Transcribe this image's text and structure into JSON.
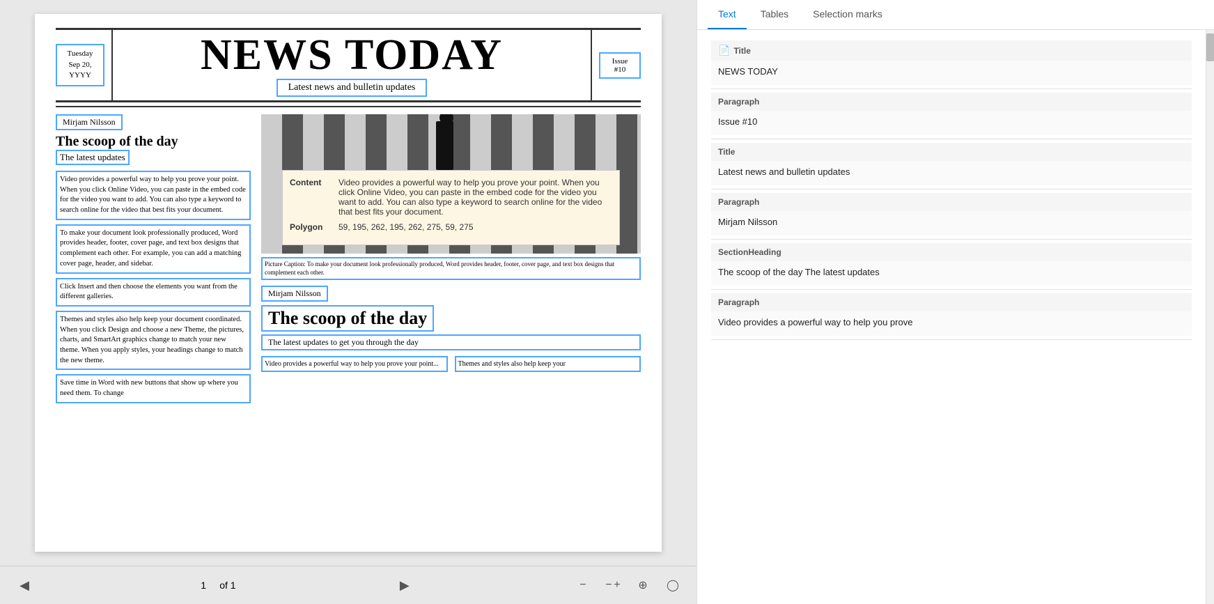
{
  "doc": {
    "date": "Tuesday\nSep 20,\nYYYY",
    "title": "NEWS TODAY",
    "subtitle": "Latest news and bulletin updates",
    "issue": "Issue\n#10",
    "author1": "Mirjam Nilsson",
    "heading1": "The scoop of the day",
    "sub1": "The latest updates",
    "para1": "Video provides a powerful way to help you prove your point. When you click Online Video, you can paste in the embed code for the video you want to add. You can also type a keyword to search online for the video that best fits your document.",
    "para2": "To make your document look professionally produced, Word provides header, footer, cover page, and text box designs that complement each other. For example, you can add a matching cover page, header, and sidebar.",
    "para3": "Click Insert and then choose the elements you want from the different galleries.",
    "para4": "Themes and styles also help keep your document coordinated. When you click Design and choose a new Theme, the pictures, charts, and SmartArt graphics change to match your new theme. When you apply styles, your headings change to match the new theme.",
    "para5": "Save time in Word with new buttons that show up where you need them. To change",
    "tooltip_label1": "Content",
    "tooltip_value1": "Video provides a powerful way to help you prove your point. When you click Online Video, you can paste in the embed code for the video you want to add. You can also type a keyword to search online for the video that best fits your document.",
    "tooltip_label2": "Polygon",
    "tooltip_value2": "59, 195, 262, 195, 262, 275, 59, 275",
    "caption": "Picture Caption: To make your document look professionally produced, Word provides header, footer, cover page, and text box designs that complement each other.",
    "author2": "Mirjam Nilsson",
    "heading2": "The scoop of the day",
    "sub2": "The latest updates to get you through the day",
    "bottom_left": "Video provides a powerf...",
    "bottom_right": "Themes and styles also help keep your"
  },
  "pagination": {
    "current": "1",
    "of_label": "of 1",
    "prev_icon": "◁",
    "next_icon": "▷"
  },
  "zoom": {
    "zoom_out": "−",
    "zoom_in": "+",
    "fit": "⊕",
    "help": "?"
  },
  "right_panel": {
    "tabs": [
      {
        "label": "Text",
        "active": true
      },
      {
        "label": "Tables",
        "active": false
      },
      {
        "label": "Selection marks",
        "active": false
      }
    ],
    "sections": [
      {
        "type_label": "Title",
        "has_icon": true,
        "value": "NEWS TODAY"
      },
      {
        "type_label": "Paragraph",
        "has_icon": false,
        "value": "Issue #10"
      },
      {
        "type_label": "Title",
        "has_icon": false,
        "value": "Latest news and bulletin updates"
      },
      {
        "type_label": "Paragraph",
        "has_icon": false,
        "value": "Mirjam Nilsson"
      },
      {
        "type_label": "SectionHeading",
        "has_icon": false,
        "value": "The scoop of the day The latest updates"
      },
      {
        "type_label": "Paragraph",
        "has_icon": false,
        "value": "Video provides a powerful way to help you prove"
      }
    ]
  }
}
